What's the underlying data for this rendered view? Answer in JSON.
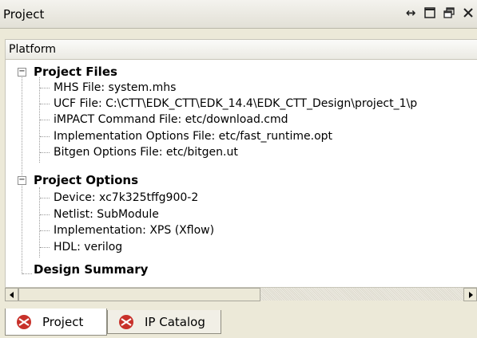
{
  "panel": {
    "title": "Project",
    "controls": [
      "move-icon",
      "maximize-icon",
      "restore-icon",
      "close-icon"
    ],
    "column_header": "Platform"
  },
  "tree": {
    "project_files": {
      "label": "Project Files",
      "items": [
        "MHS File: system.mhs",
        "UCF File: C:\\CTT\\EDK_CTT\\EDK_14.4\\EDK_CTT_Design\\project_1\\p",
        "iMPACT Command File: etc/download.cmd",
        "Implementation Options File: etc/fast_runtime.opt",
        "Bitgen Options File: etc/bitgen.ut"
      ]
    },
    "project_options": {
      "label": "Project Options",
      "items": [
        "Device: xc7k325tffg900-2",
        "Netlist: SubModule",
        "Implementation: XPS (Xflow)",
        "HDL: verilog"
      ]
    },
    "design_summary": {
      "label": "Design Summary"
    }
  },
  "tabs": [
    {
      "label": "Project",
      "icon": "xilinx-icon",
      "active": true
    },
    {
      "label": "IP Catalog",
      "icon": "xilinx-icon",
      "active": false
    }
  ]
}
